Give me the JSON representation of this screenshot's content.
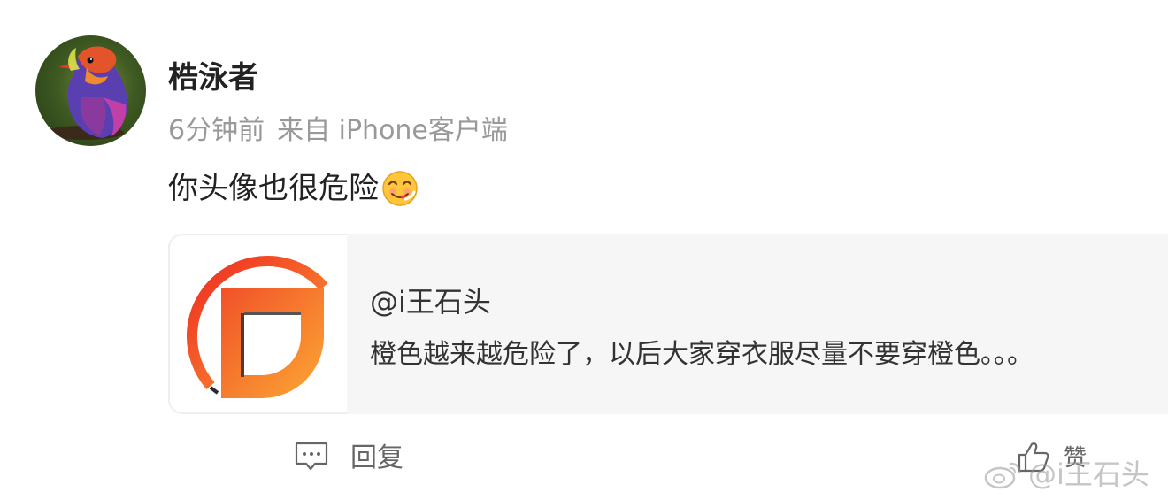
{
  "post": {
    "author_name": "梏泳者",
    "time": "6分钟前",
    "source": "来自 iPhone客户端",
    "text": "你头像也很危险",
    "emoji": "yum-face-emoji"
  },
  "quote": {
    "author": "@i王石头",
    "text": "橙色越来越危险了，以后大家穿衣服尽量不要穿橙色。。。"
  },
  "actions": {
    "reply_label": "回复",
    "like_label": "赞"
  },
  "watermark": {
    "text": "@i王石头"
  },
  "colors": {
    "name": "#222222",
    "meta": "#999999",
    "card_bg": "#f6f6f6",
    "logo_red": "#f0291f",
    "logo_orange": "#f99a2c"
  }
}
